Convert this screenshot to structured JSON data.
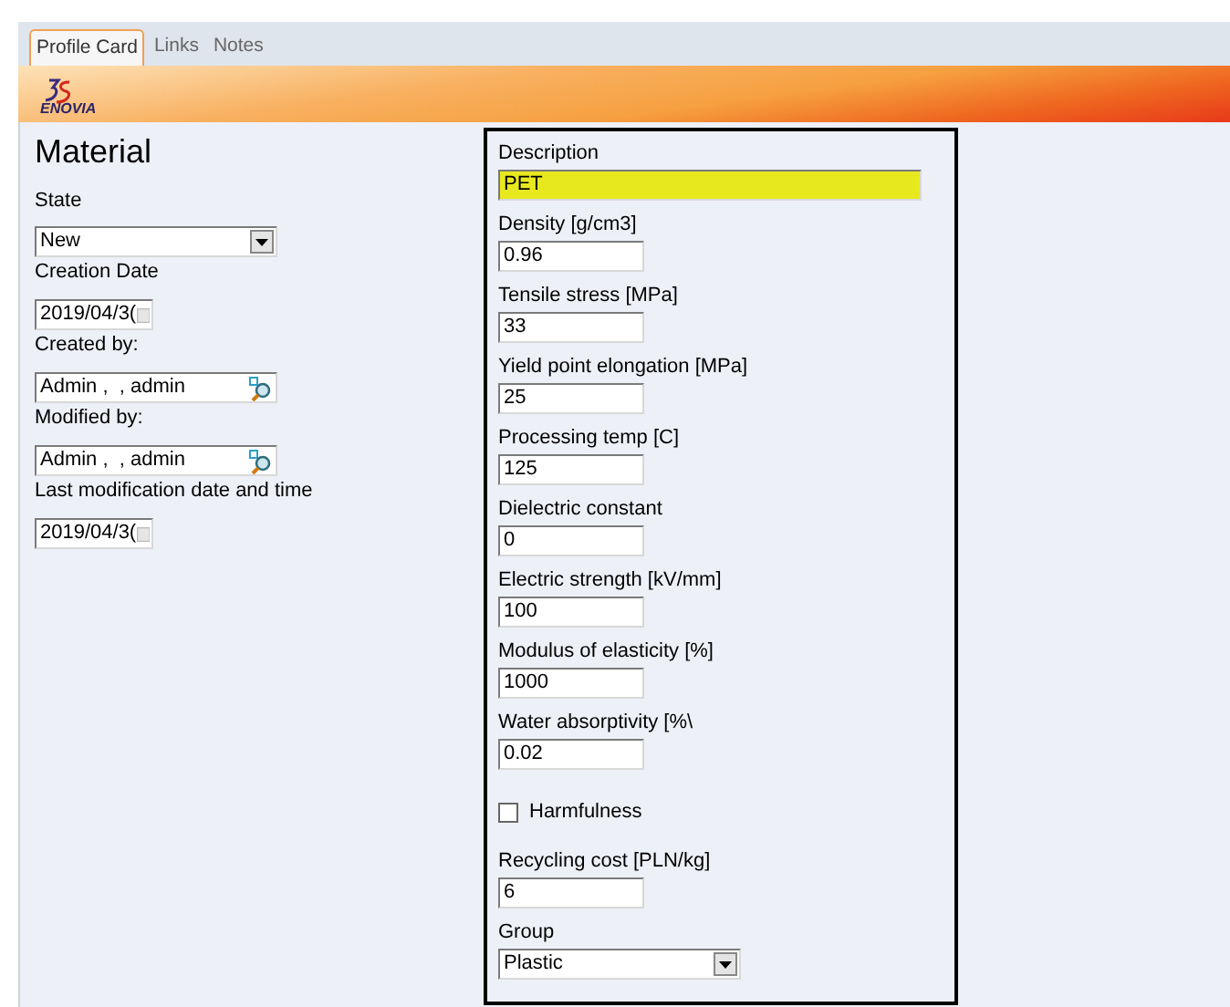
{
  "tabs": [
    {
      "label": "Profile Card",
      "selected": true
    },
    {
      "label": "Links",
      "selected": false
    },
    {
      "label": "Notes",
      "selected": false
    }
  ],
  "banner": {
    "logo_text": "ENOVIA"
  },
  "title": "Material",
  "left_fields": [
    {
      "kind": "select",
      "label": "State",
      "value": "New"
    },
    {
      "kind": "date",
      "label": "Creation Date",
      "value": "2019/04/3("
    },
    {
      "kind": "lookup",
      "label": "Created by:",
      "value": "Admin ,  , admin"
    },
    {
      "kind": "lookup",
      "label": "Modified by:",
      "value": "Admin ,  , admin"
    },
    {
      "kind": "date",
      "label": "Last modification date and time",
      "value": "2019/04/3("
    }
  ],
  "right_fields": [
    {
      "kind": "wide_text",
      "label": "Description",
      "value": "PET",
      "highlighted": true
    },
    {
      "kind": "text",
      "label": "Density [g/cm3]",
      "value": "0.96",
      "highlighted": false
    },
    {
      "kind": "text",
      "label": "Tensile stress [MPa]",
      "value": "33",
      "highlighted": false
    },
    {
      "kind": "text",
      "label": "Yield point elongation [MPa]",
      "value": "25",
      "highlighted": false
    },
    {
      "kind": "text",
      "label": "Processing temp [C]",
      "value": "125",
      "highlighted": false
    },
    {
      "kind": "text",
      "label": "Dielectric constant",
      "value": "0",
      "highlighted": false
    },
    {
      "kind": "text",
      "label": "Electric strength [kV/mm]",
      "value": "100",
      "highlighted": false
    },
    {
      "kind": "text",
      "label": "Modulus of elasticity [%]",
      "value": "1000",
      "highlighted": false
    },
    {
      "kind": "text",
      "label": "Water absorptivity [%\\",
      "value": "0.02",
      "highlighted": false
    },
    {
      "kind": "checkbox",
      "label": "Harmfulness",
      "checked": false
    },
    {
      "kind": "text",
      "label": "Recycling cost [PLN/kg]",
      "value": "6",
      "highlighted": false
    },
    {
      "kind": "select",
      "label": "Group",
      "value": "Plastic"
    }
  ]
}
